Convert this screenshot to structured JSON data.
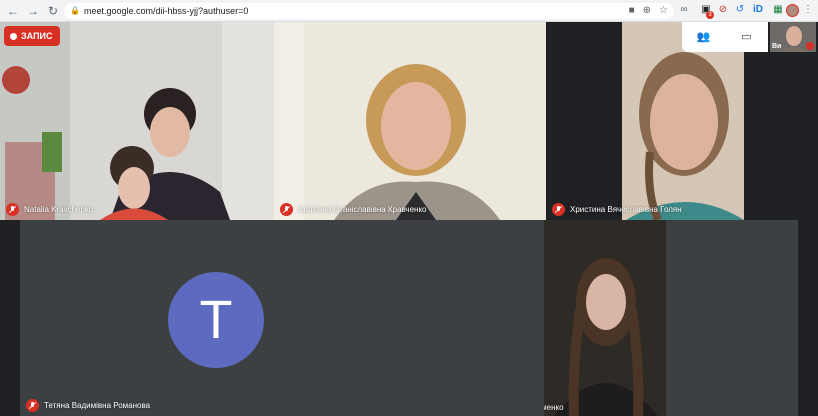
{
  "browser": {
    "url": "meet.google.com/dii-hbss-yjj?authuser=0",
    "extension_badge": "3"
  },
  "meet": {
    "record_label": "ЗАПИС",
    "self_label": "Ви",
    "accent_color": "#d93025",
    "avatar_color": "#5c6bc0",
    "participants": [
      {
        "name": "Natalia Kravchenko",
        "muted": true
      },
      {
        "name": "Світлана Станіславівна Кравченко",
        "muted": true
      },
      {
        "name": "Христина Вячеславівна Голян",
        "muted": true
      },
      {
        "name": "Тетяна Вадимівна Романова",
        "muted": true,
        "avatar_letter": "T"
      },
      {
        "name": "Єлизавета Вікторівна Соломенко",
        "muted": false
      }
    ]
  }
}
